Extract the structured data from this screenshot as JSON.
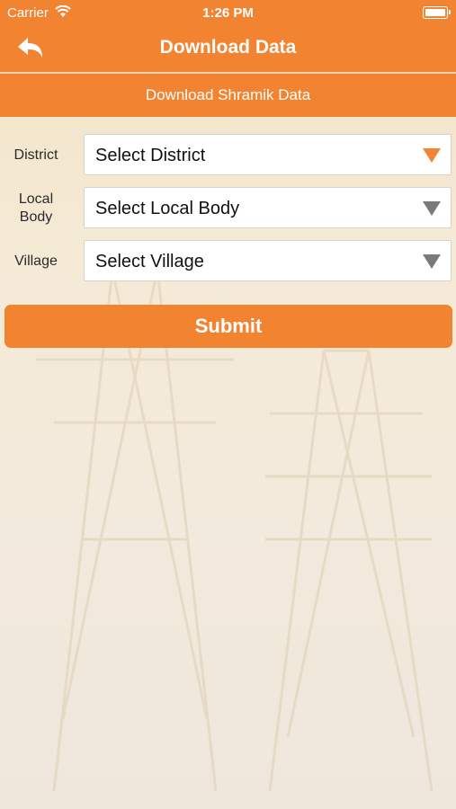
{
  "status_bar": {
    "carrier": "Carrier",
    "time": "1:26 PM"
  },
  "nav": {
    "title": "Download Data"
  },
  "sub_header": {
    "title": "Download Shramik Data"
  },
  "form": {
    "district": {
      "label": "District",
      "value": "Select District"
    },
    "local_body": {
      "label_line1": "Local",
      "label_line2": "Body",
      "value": "Select Local Body"
    },
    "village": {
      "label": "Village",
      "value": "Select Village"
    }
  },
  "submit_label": "Submit",
  "colors": {
    "accent": "#f28431",
    "background": "#f3e8d6"
  }
}
